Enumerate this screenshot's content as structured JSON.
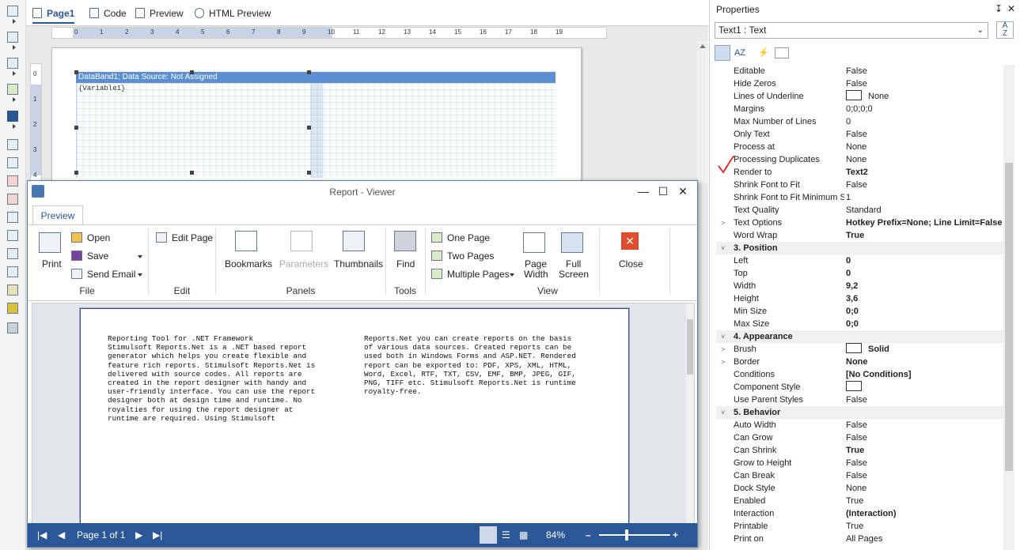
{
  "designer": {
    "tabs": [
      {
        "label": "Page1"
      },
      {
        "label": "Code"
      },
      {
        "label": "Preview"
      },
      {
        "label": "HTML Preview"
      }
    ],
    "ruler_h_ticks": [
      "0",
      "1",
      "2",
      "3",
      "4",
      "5",
      "6",
      "7",
      "8",
      "9",
      "10",
      "11",
      "12",
      "13",
      "14",
      "15",
      "16",
      "17",
      "18",
      "19"
    ],
    "ruler_v_ticks": [
      "0",
      "1",
      "2",
      "3",
      "4"
    ],
    "databand_label": "DataBand1; Data Source: Not Assigned",
    "variable_text": "{Variable1}"
  },
  "viewer": {
    "title": "Report - Viewer",
    "ribbon_tab": "Preview",
    "groups": {
      "file": {
        "label": "File",
        "print": "Print",
        "open": "Open",
        "save": "Save",
        "send_email": "Send Email"
      },
      "edit": {
        "label": "Edit",
        "edit_page": "Edit Page"
      },
      "panels": {
        "label": "Panels",
        "bookmarks": "Bookmarks",
        "parameters": "Parameters",
        "thumbnails": "Thumbnails"
      },
      "tools": {
        "label": "Tools",
        "find": "Find"
      },
      "view": {
        "label": "View",
        "one_page": "One Page",
        "two_pages": "Two Pages",
        "multiple_pages": "Multiple Pages",
        "page_width_1": "Page",
        "page_width_2": "Width",
        "full_screen_1": "Full",
        "full_screen_2": "Screen"
      },
      "close": {
        "label": "Close"
      }
    },
    "report_col1": "Reporting Tool for .NET Framework\nStimulsoft Reports.Net is a .NET based report\ngenerator which helps you create flexible and\nfeature rich reports. Stimulsoft Reports.Net is\ndelivered with source codes. All reports are\ncreated in the report designer with handy and\nuser-friendly interface. You can use the report\ndesigner both at design time and runtime. No\nroyalties for using the report designer at\nruntime are required. Using Stimulsoft",
    "report_col2": "Reports.Net you can create reports on the basis\nof various data sources. Created reports can be\nused both in Windows Forms and ASP.NET. Rendered\nreport can be exported to: PDF, XPS, XML, HTML,\nWord, Excel, RTF, TXT, CSV, EMF, BMP, JPEG, GIF,\nPNG, TIFF etc. Stimulsoft Reports.Net is runtime\nroyalty-free.",
    "status": {
      "page": "Page 1 of 1",
      "zoom": "84%"
    }
  },
  "properties": {
    "title": "Properties",
    "selected": "Text1 : Text",
    "rows": [
      {
        "name": "Editable",
        "value": "False"
      },
      {
        "name": "Hide Zeros",
        "value": "False"
      },
      {
        "name": "Lines of Underline",
        "value": "None",
        "swatch": true
      },
      {
        "name": "Margins",
        "value": "0;0;0;0"
      },
      {
        "name": "Max Number of Lines",
        "value": "0"
      },
      {
        "name": "Only Text",
        "value": "False"
      },
      {
        "name": "Process at",
        "value": "None"
      },
      {
        "name": "Processing Duplicates",
        "value": "None"
      },
      {
        "name": "Render to",
        "value": "Text2",
        "bold": true
      },
      {
        "name": "Shrink Font to Fit",
        "value": "False"
      },
      {
        "name": "Shrink Font to Fit Minimum Si:",
        "value": "1"
      },
      {
        "name": "Text Quality",
        "value": "Standard"
      },
      {
        "name": "Text Options",
        "value": "Hotkey Prefix=None; Line Limit=False",
        "bold": true,
        "expand": ">"
      },
      {
        "name": "Word Wrap",
        "value": "True",
        "bold": true
      },
      {
        "name": "3. Position",
        "category": true
      },
      {
        "name": "Left",
        "value": "0",
        "bold": true
      },
      {
        "name": "Top",
        "value": "0",
        "bold": true
      },
      {
        "name": "Width",
        "value": "9,2",
        "bold": true
      },
      {
        "name": "Height",
        "value": "3,6",
        "bold": true
      },
      {
        "name": "Min Size",
        "value": "0;0",
        "bold": true
      },
      {
        "name": "Max Size",
        "value": "0;0",
        "bold": true
      },
      {
        "name": "4. Appearance",
        "category": true
      },
      {
        "name": "Brush",
        "value": "Solid",
        "bold": true,
        "swatch": true,
        "expand": ">"
      },
      {
        "name": "Border",
        "value": "None",
        "bold": true,
        "expand": ">"
      },
      {
        "name": "Conditions",
        "value": "[No Conditions]",
        "bold": true
      },
      {
        "name": "Component Style",
        "value": "",
        "swatch": true
      },
      {
        "name": "Use Parent Styles",
        "value": "False"
      },
      {
        "name": "5. Behavior",
        "category": true
      },
      {
        "name": "Auto Width",
        "value": "False"
      },
      {
        "name": "Can Grow",
        "value": "False"
      },
      {
        "name": "Can Shrink",
        "value": "True",
        "bold": true
      },
      {
        "name": "Grow to Height",
        "value": "False"
      },
      {
        "name": "Can Break",
        "value": "False"
      },
      {
        "name": "Dock Style",
        "value": "None"
      },
      {
        "name": "Enabled",
        "value": "True"
      },
      {
        "name": "Interaction",
        "value": "(Interaction)",
        "bold": true
      },
      {
        "name": "Printable",
        "value": "True"
      },
      {
        "name": "Print on",
        "value": "All Pages"
      }
    ]
  },
  "colors": {
    "accent": "#2b5797",
    "databand": "#5b8fd1",
    "checkmark": "#e02020",
    "close": "#e04b2c"
  }
}
